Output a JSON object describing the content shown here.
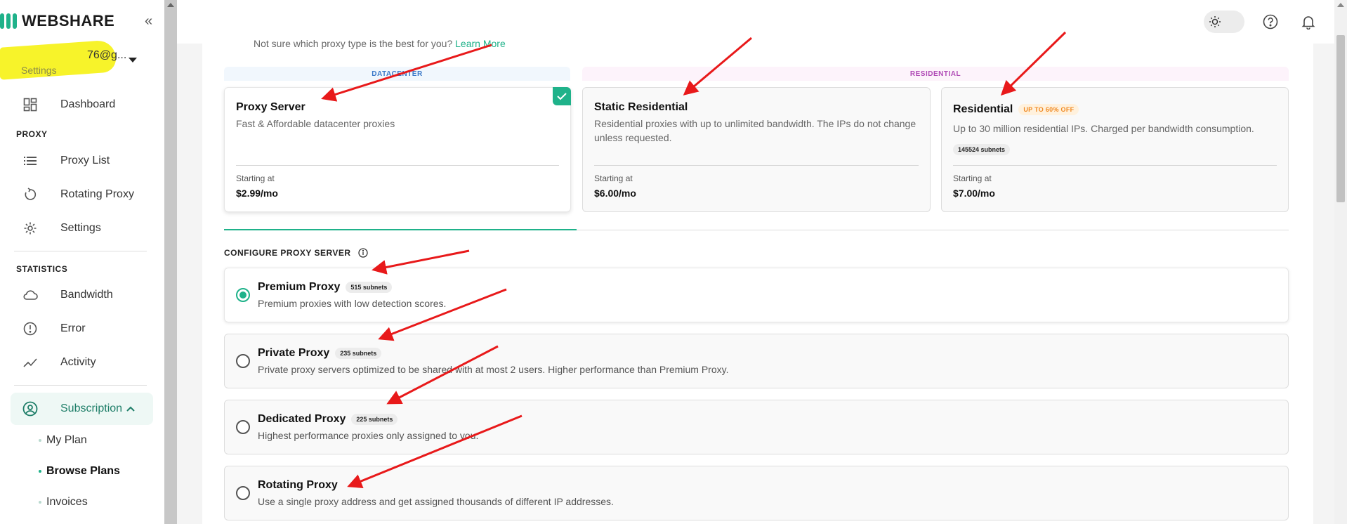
{
  "brand": {
    "name": "WEBSHARE"
  },
  "account": {
    "email": "76@g...",
    "subtitle": "Settings"
  },
  "sidebar": {
    "top_items": [
      {
        "label": "Dashboard"
      }
    ],
    "sections": {
      "proxy": "PROXY",
      "statistics": "STATISTICS"
    },
    "proxy_items": [
      {
        "label": "Proxy List"
      },
      {
        "label": "Rotating Proxy"
      },
      {
        "label": "Settings"
      }
    ],
    "stats_items": [
      {
        "label": "Bandwidth"
      },
      {
        "label": "Error"
      },
      {
        "label": "Activity"
      }
    ],
    "subscription": {
      "label": "Subscription"
    },
    "sub_items": [
      {
        "label": "My Plan"
      },
      {
        "label": "Browse Plans"
      },
      {
        "label": "Invoices"
      }
    ]
  },
  "hint": {
    "text": "Not sure which proxy type is the best for you?",
    "link": "Learn More"
  },
  "categories": {
    "datacenter": "DATACENTER",
    "residential": "RESIDENTIAL"
  },
  "proxy_types": [
    {
      "title": "Proxy Server",
      "desc": "Fast & Affordable datacenter proxies",
      "start_label": "Starting at",
      "price": "$2.99/mo"
    },
    {
      "title": "Static Residential",
      "desc": "Residential proxies with up to unlimited bandwidth. The IPs do not change unless requested.",
      "start_label": "Starting at",
      "price": "$6.00/mo"
    },
    {
      "title": "Residential",
      "badge": "UP TO 60% OFF",
      "desc": "Up to 30 million residential IPs. Charged per bandwidth consumption.",
      "subnets": "145524 subnets",
      "start_label": "Starting at",
      "price": "$7.00/mo"
    }
  ],
  "config": {
    "title": "CONFIGURE PROXY SERVER",
    "options": [
      {
        "title": "Premium Proxy",
        "subnets": "515 subnets",
        "desc": "Premium proxies with low detection scores."
      },
      {
        "title": "Private Proxy",
        "subnets": "235 subnets",
        "desc": "Private proxy servers optimized to be shared with at most 2 users. Higher performance than Premium Proxy."
      },
      {
        "title": "Dedicated Proxy",
        "subnets": "225 subnets",
        "desc": "Highest performance proxies only assigned to you."
      },
      {
        "title": "Rotating Proxy",
        "desc": "Use a single proxy address and get assigned thousands of different IP addresses."
      }
    ]
  },
  "colors": {
    "accent": "#1fb28a",
    "annotation": "#e8191a",
    "highlight": "#f7f32a"
  },
  "icons": {
    "theme": "sun-icon",
    "help": "help-circle-icon",
    "notifications": "bell-icon"
  }
}
